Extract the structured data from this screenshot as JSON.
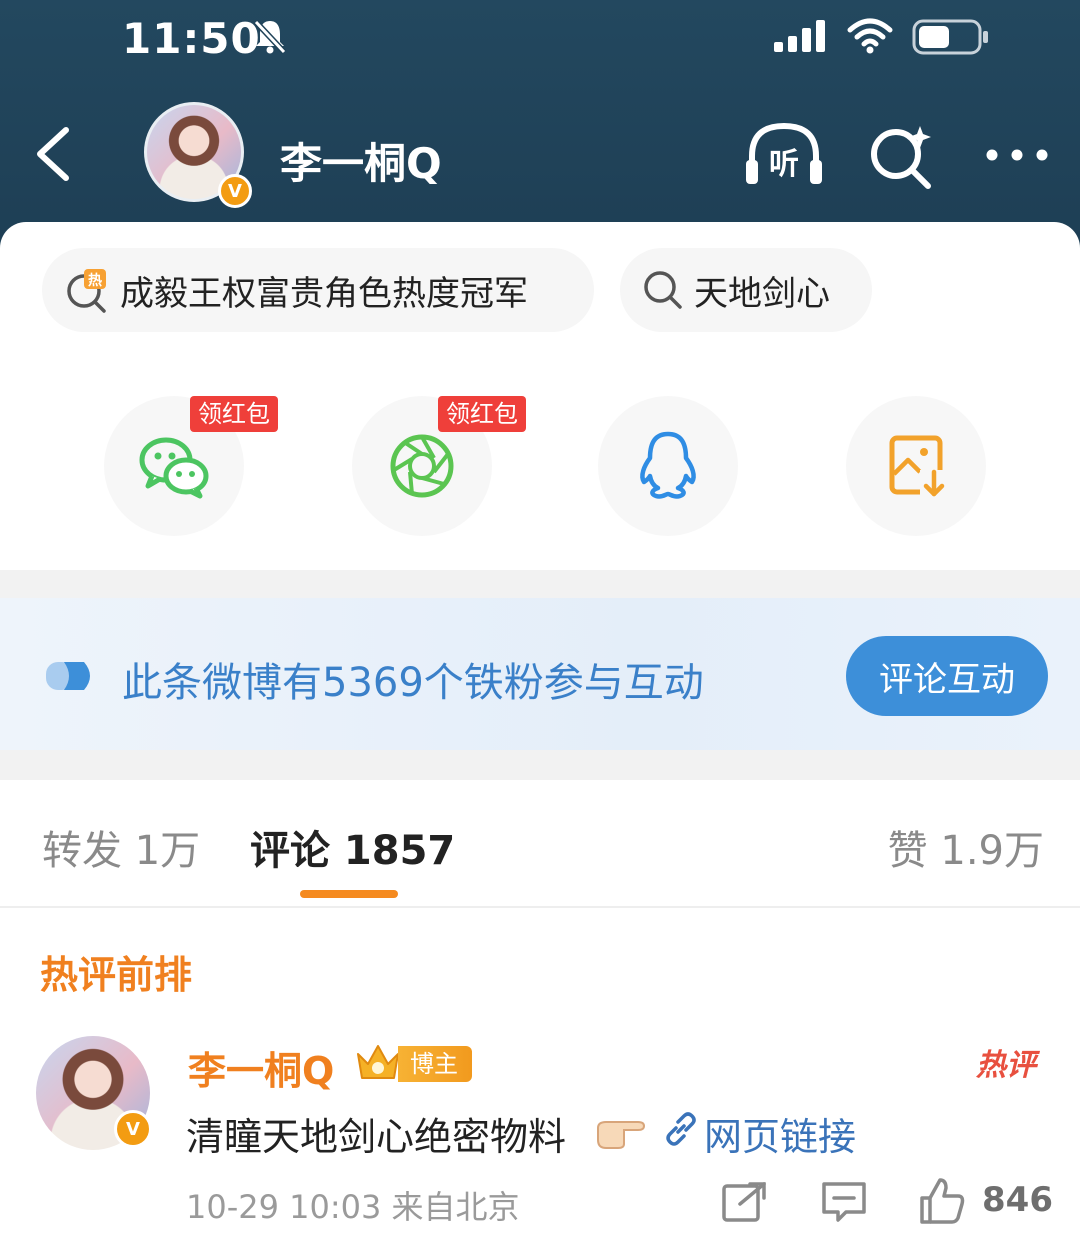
{
  "status_bar": {
    "time": "11:50",
    "icons": [
      "bell-muted-icon",
      "signal-icon",
      "wifi-icon",
      "battery-icon"
    ]
  },
  "header": {
    "back_icon": "back-chevron-icon",
    "username": "李一桐Q",
    "verified_badge": "V",
    "listen_label": "听",
    "search_icon": "search-sparkle-icon",
    "more_icon": "more-dots-icon"
  },
  "topics": [
    {
      "icon": "hot-search-icon",
      "label": "成毅王权富贵角色热度冠军"
    },
    {
      "icon": "search-icon",
      "label": "天地剑心"
    }
  ],
  "share": {
    "buttons": [
      {
        "icon": "wechat-icon",
        "tag": "领红包"
      },
      {
        "icon": "moments-icon",
        "tag": "领红包"
      },
      {
        "icon": "qq-icon",
        "tag": ""
      },
      {
        "icon": "save-image-icon",
        "tag": ""
      }
    ]
  },
  "fan_banner": {
    "text": "此条微博有5369个铁粉参与互动",
    "button": "评论互动"
  },
  "tabs": {
    "forward": "转发 1万",
    "comments": "评论 1857",
    "likes": "赞 1.9万"
  },
  "hot_section_label": "热评前排",
  "comment": {
    "username": "李一桐Q",
    "badge": "博主",
    "verified_badge": "V",
    "hot_tag": "热评",
    "text": "清瞳天地剑心绝密物料",
    "link_text": "网页链接",
    "meta": "10-29 10:03 来自北京",
    "likes": "846"
  },
  "colors": {
    "header_bg": "#1f4258",
    "accent_orange": "#f0801f",
    "link_blue": "#3a73b9",
    "fan_blue": "#3d8fd9",
    "red_tag": "#ef3f3a"
  }
}
